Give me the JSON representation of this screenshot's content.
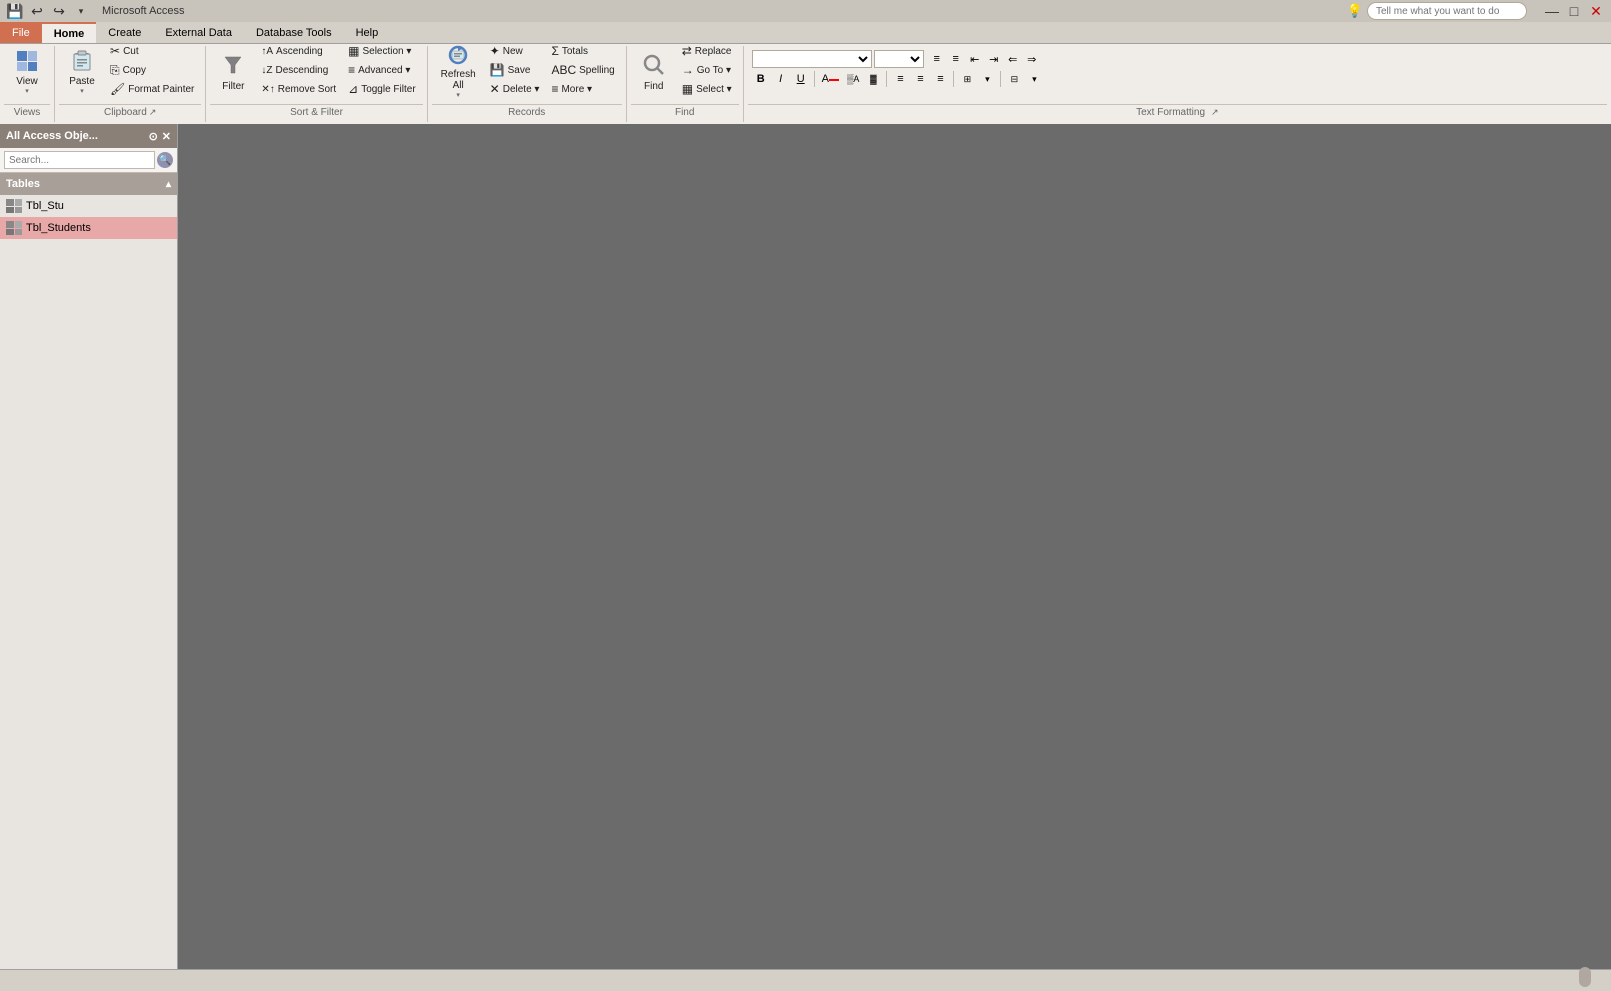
{
  "app": {
    "title": "Microsoft Access",
    "quick_access": {
      "buttons": [
        "💾",
        "↩",
        "↪"
      ]
    }
  },
  "menubar": {
    "items": [
      "File",
      "Home",
      "Create",
      "External Data",
      "Database Tools",
      "Help"
    ]
  },
  "ribbon": {
    "active_tab": "Home",
    "tabs": [
      "File",
      "Home",
      "Create",
      "External Data",
      "Database Tools",
      "Help"
    ],
    "tell_me_placeholder": "Tell me what you want to do",
    "groups": {
      "views": {
        "label": "Views",
        "view_btn": "View"
      },
      "clipboard": {
        "label": "Clipboard",
        "paste_label": "Paste",
        "cut_label": "Cut",
        "copy_label": "Copy",
        "format_painter_label": "Format Painter"
      },
      "sort_filter": {
        "label": "Sort & Filter",
        "filter_label": "Filter",
        "ascending_label": "Ascending",
        "descending_label": "Descending",
        "remove_sort_label": "Remove Sort",
        "selection_label": "Selection ▾",
        "advanced_label": "Advanced ▾",
        "toggle_filter_label": "Toggle Filter"
      },
      "records": {
        "label": "Records",
        "new_label": "New",
        "save_label": "Save",
        "delete_label": "Delete ▾",
        "totals_label": "Totals",
        "spelling_label": "Spelling",
        "more_label": "More ▾",
        "refresh_label": "Refresh\nAll ▾"
      },
      "find": {
        "label": "Find",
        "find_label": "Find",
        "replace_label": "Replace",
        "goto_label": "Go To ▾",
        "select_label": "Select ▾"
      },
      "text_formatting": {
        "label": "Text Formatting",
        "font_name": "",
        "font_size": "",
        "bold_label": "B",
        "italic_label": "I",
        "underline_label": "U",
        "align_left": "≡",
        "align_center": "≡",
        "align_right": "≡"
      }
    }
  },
  "nav_pane": {
    "header_title": "All Access Obje...",
    "search_placeholder": "Search...",
    "sections": [
      {
        "name": "Tables",
        "items": [
          {
            "name": "Tbl_Stu",
            "selected": false
          },
          {
            "name": "Tbl_Students",
            "selected": true
          }
        ]
      }
    ]
  }
}
